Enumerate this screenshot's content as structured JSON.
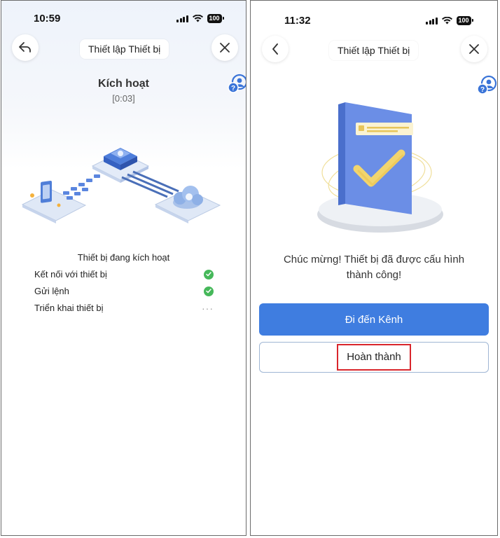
{
  "left": {
    "status": {
      "time": "10:59",
      "battery": "100"
    },
    "header": {
      "title": "Thiết lập Thiết bị"
    },
    "activation": {
      "title": "Kích hoạt",
      "timer": "[0:03]"
    },
    "progress": {
      "heading": "Thiết bị đang kích hoạt",
      "steps": [
        {
          "label": "Kết nối với thiết bị",
          "state": "done"
        },
        {
          "label": "Gửi lệnh",
          "state": "done"
        },
        {
          "label": "Triển khai thiết bị",
          "state": "pending",
          "indicator": "···"
        }
      ]
    }
  },
  "right": {
    "status": {
      "time": "11:32",
      "battery": "100"
    },
    "header": {
      "title": "Thiết lập Thiết bị"
    },
    "success": {
      "line1": "Chúc mừng! Thiết bị đã được cấu hình",
      "line2": "thành công!"
    },
    "buttons": {
      "primary": "Đi đến Kênh",
      "secondary": "Hoàn thành"
    }
  },
  "icons": {
    "back": "back-arrow-icon",
    "chevron": "chevron-left-icon",
    "close": "close-icon",
    "help": "user-help-icon",
    "check": "check-circle-icon",
    "signal": "signal-icon",
    "wifi": "wifi-icon",
    "battery": "battery-icon"
  },
  "colors": {
    "primary": "#3f7de0",
    "success": "#46b85a",
    "highlight": "#d9262c",
    "iconBlue": "#3a74d8"
  }
}
